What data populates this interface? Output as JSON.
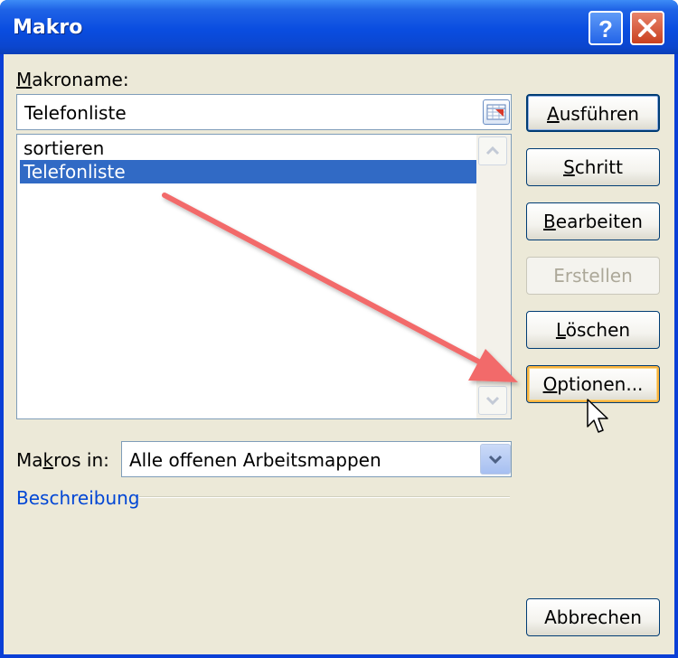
{
  "window": {
    "title": "Makro",
    "help_glyph": "?",
    "close_glyph": "×"
  },
  "makroname": {
    "label_accel": "M",
    "label_rest": "akroname:",
    "value": "Telefonliste"
  },
  "macro_list": {
    "items": [
      {
        "label": "sortieren",
        "selected": false
      },
      {
        "label": "Telefonliste",
        "selected": true
      }
    ]
  },
  "buttons": {
    "run": {
      "accel": "A",
      "rest": "usführen"
    },
    "step": {
      "accel": "S",
      "rest": "chritt"
    },
    "edit": {
      "accel": "B",
      "rest": "earbeiten"
    },
    "create": {
      "label": "Erstellen"
    },
    "delete": {
      "accel": "L",
      "rest": "öschen"
    },
    "options": {
      "accel": "O",
      "rest": "ptionen..."
    },
    "cancel": {
      "label": "Abbrechen"
    }
  },
  "macros_in": {
    "label_pre": "Ma",
    "label_accel": "k",
    "label_post": "ros in:",
    "value": "Alle offenen Arbeitsmappen"
  },
  "description": {
    "label": "Beschreibung"
  },
  "annotation": {
    "arrow_color": "#f26a6a"
  },
  "colors": {
    "title_bar": "#0a4de0",
    "selection": "#316ac5",
    "dialog_bg": "#ece9d8"
  }
}
